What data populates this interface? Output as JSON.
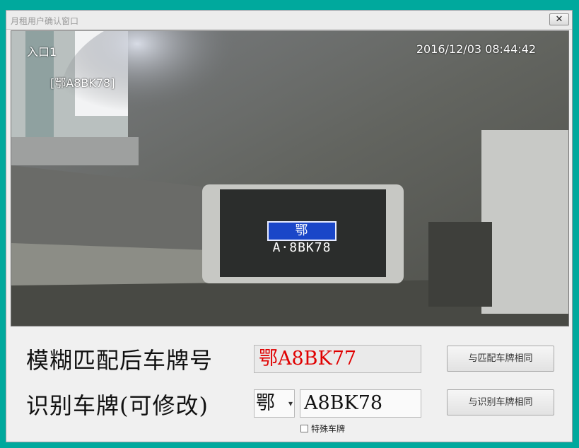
{
  "window": {
    "title": "月租用户确认窗口",
    "close_glyph": "✕"
  },
  "camera": {
    "entrance_label": "入口1",
    "timestamp": "2016/12/03  08:44:42",
    "detected_plate_tag": "[鄂A8BK78]",
    "plate_in_image": "鄂A·8BK78"
  },
  "form": {
    "fuzzy_label": "模糊匹配后车牌号",
    "fuzzy_value": "鄂A8BK77",
    "recognized_label": "识别车牌(可修改)",
    "province_value": "鄂",
    "plate_value": "A8BK78",
    "special_plate_label": "特殊车牌",
    "special_plate_checked": false
  },
  "buttons": {
    "same_as_matched": "与匹配车牌相同",
    "same_as_recognized": "与识别车牌相同"
  },
  "colors": {
    "desktop": "#00a99d",
    "fuzzy_text": "#e00000",
    "plate_blue": "#1a46c8"
  }
}
